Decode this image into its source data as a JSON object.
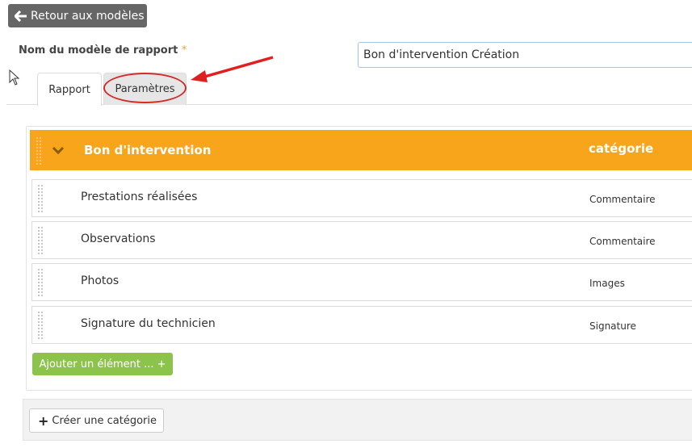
{
  "header": {
    "back_label": "Retour aux modèles"
  },
  "form": {
    "name_label": "Nom du modèle de rapport",
    "required_mark": "*",
    "name_value": "Bon d'intervention Création"
  },
  "tabs": [
    {
      "label": "Rapport",
      "active": true
    },
    {
      "label": "Paramètres",
      "active": false,
      "highlighted": true
    }
  ],
  "category": {
    "title": "Bon d'intervention",
    "column_header": "catégorie",
    "color": "#f8a51b",
    "items": [
      {
        "label": "Prestations réalisées",
        "category": "Commentaire"
      },
      {
        "label": "Observations",
        "category": "Commentaire"
      },
      {
        "label": "Photos",
        "category": "Images"
      },
      {
        "label": "Signature du technicien",
        "category": "Signature"
      }
    ]
  },
  "actions": {
    "add_element_label": "Ajouter un élément ... +",
    "create_category_label": "Créer une catégorie"
  },
  "icons": {
    "back": "arrow-left-icon",
    "collapse": "chevron-down-icon",
    "drag": "drag-handle-icon",
    "add": "plus-icon",
    "annotation_arrow": "red-arrow"
  }
}
